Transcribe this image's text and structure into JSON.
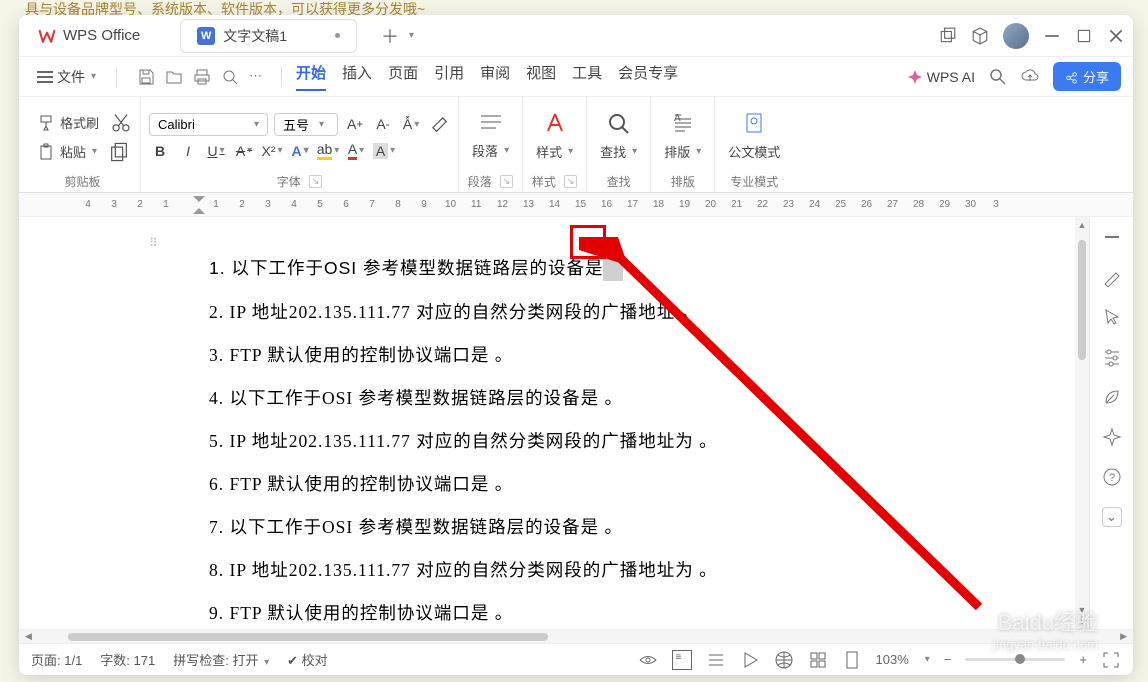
{
  "top_hint": "具与设备品牌型号、系统版本、软件版本，可以获得更多分发哦~",
  "app": {
    "name": "WPS Office"
  },
  "tab": {
    "title": "文字文稿1"
  },
  "file_menu": "文件",
  "menu_tabs": [
    "开始",
    "插入",
    "页面",
    "引用",
    "审阅",
    "视图",
    "工具",
    "会员专享"
  ],
  "ai_label": "WPS AI",
  "share_label": "分享",
  "ribbon": {
    "clipboard": {
      "format_painter": "格式刷",
      "paste": "粘贴",
      "label": "剪贴板"
    },
    "font": {
      "family": "Calibri",
      "size": "五号",
      "label": "字体"
    },
    "paragraph": {
      "btn": "段落",
      "label": "段落"
    },
    "styles": {
      "btn": "样式",
      "label": "样式"
    },
    "find": {
      "btn": "查找",
      "label": "查找"
    },
    "layout": {
      "btn": "排版",
      "label": "排版"
    },
    "mode": {
      "btn": "公文模式",
      "label": "专业模式"
    }
  },
  "ruler_left": [
    "4",
    "3",
    "2",
    "1"
  ],
  "ruler_right": [
    "1",
    "2",
    "3",
    "4",
    "5",
    "6",
    "7",
    "8",
    "9",
    "10",
    "11",
    "12",
    "13",
    "14",
    "15",
    "16",
    "17",
    "18",
    "19",
    "20",
    "21",
    "22",
    "23",
    "24",
    "25",
    "26",
    "27",
    "28",
    "29",
    "30",
    "3"
  ],
  "paragraphs": [
    "1. 以下工作于OSI 参考模型数据链路层的设备是",
    "2. IP 地址202.135.111.77 对应的自然分类网段的广播地址   。",
    "3. FTP 默认使用的控制协议端口是   。",
    "4. 以下工作于OSI 参考模型数据链路层的设备是   。",
    "5. IP 地址202.135.111.77 对应的自然分类网段的广播地址为   。",
    "6. FTP 默认使用的控制协议端口是   。",
    "7. 以下工作于OSI 参考模型数据链路层的设备是   。",
    "8. IP 地址202.135.111.77 对应的自然分类网段的广播地址为   。",
    "9. FTP 默认使用的控制协议端口是   。"
  ],
  "status": {
    "page": "页面: 1/1",
    "words": "字数: 171",
    "spell": "拼写检查: 打开",
    "proof": "校对",
    "zoom": "103%"
  },
  "watermark": {
    "brand": "Baidu经验",
    "url": "jingyan.baidu.com"
  }
}
